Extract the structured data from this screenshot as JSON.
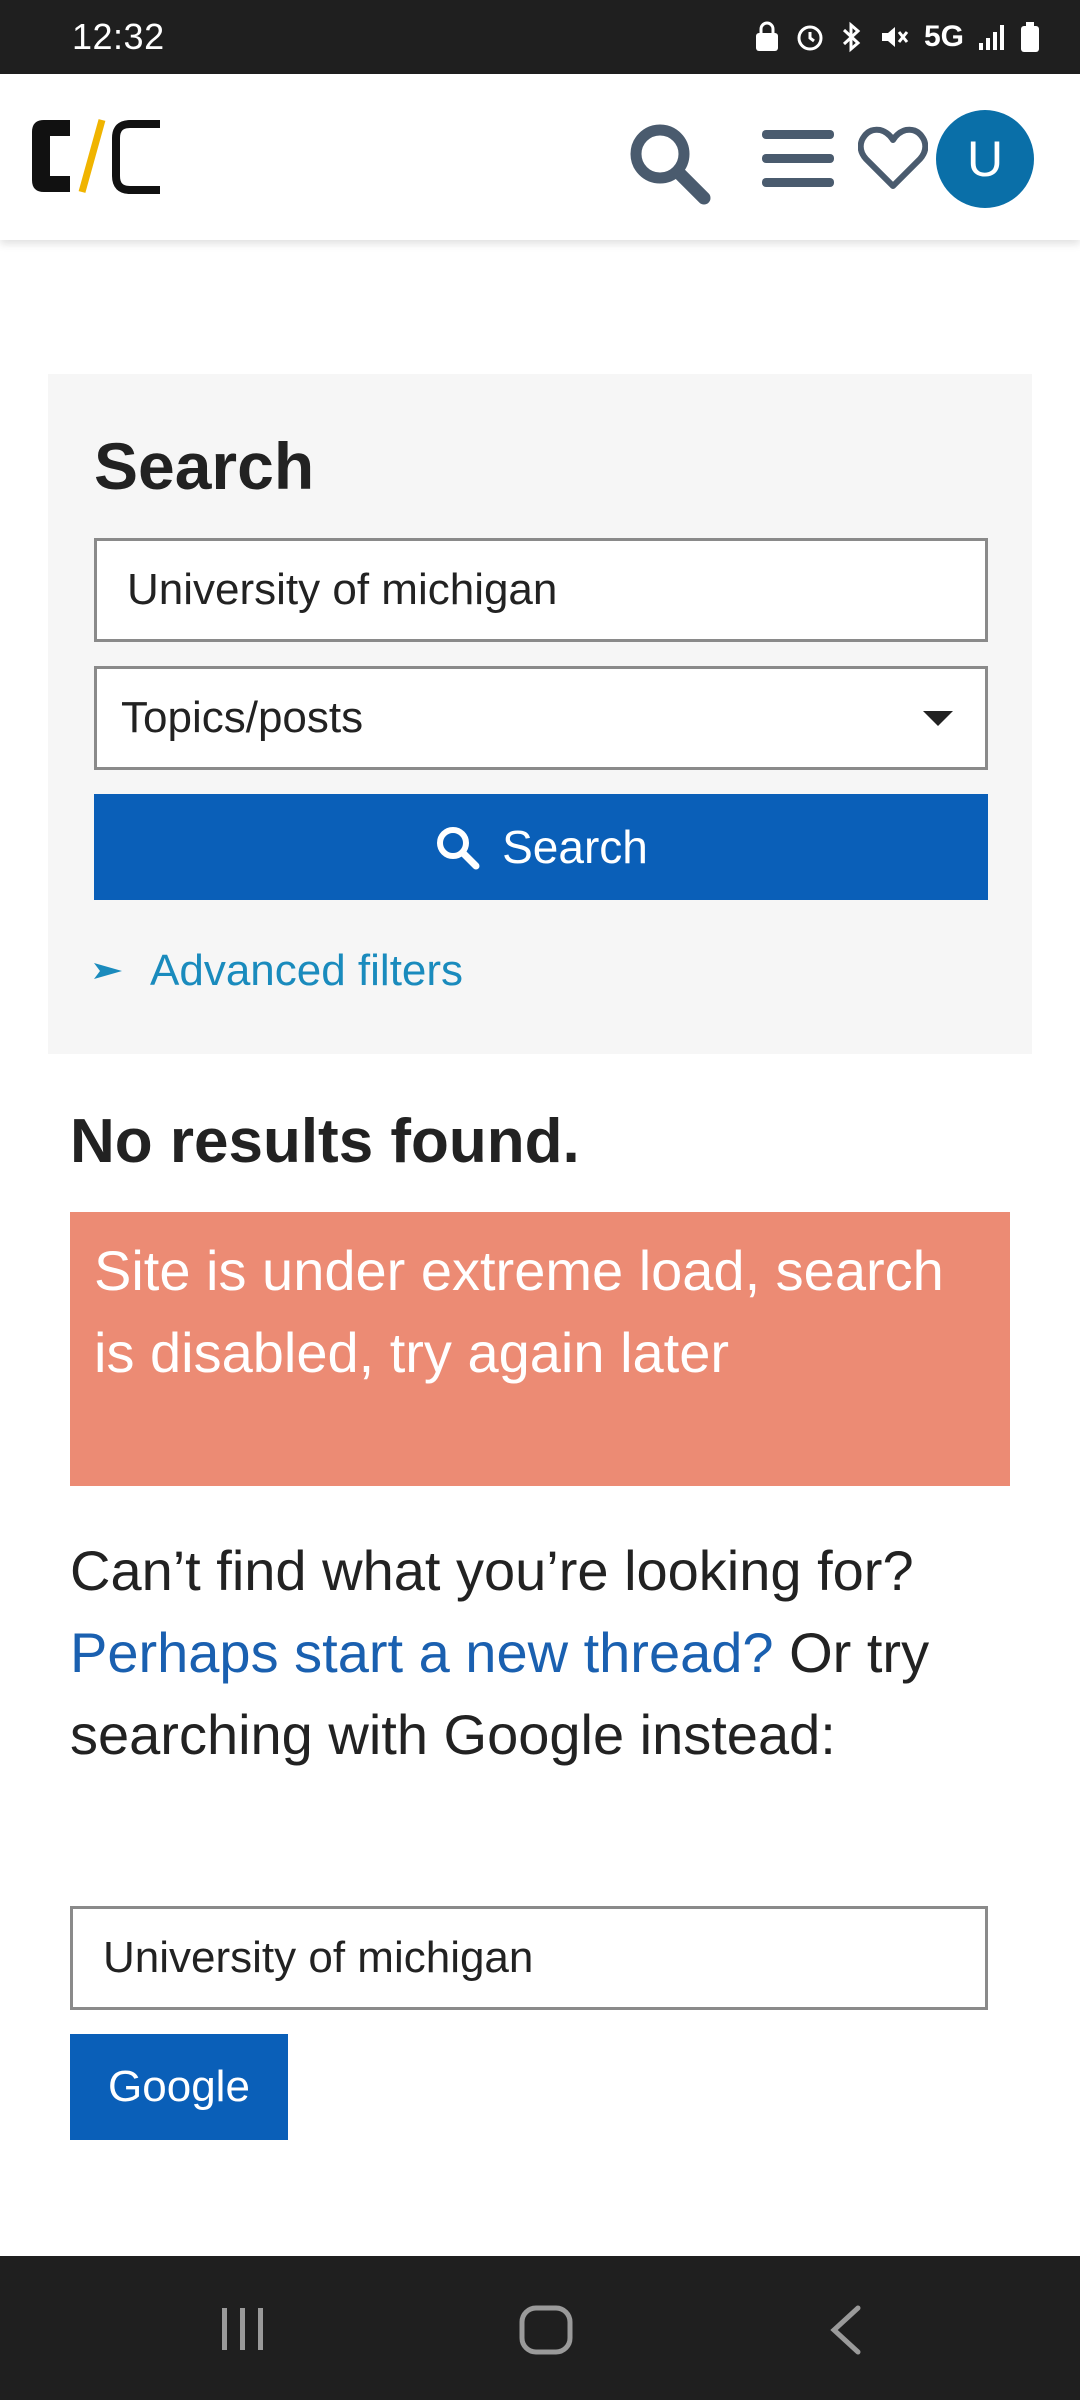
{
  "status_bar": {
    "time": "12:32",
    "network": "5G",
    "icons": [
      "lock-icon",
      "alarm-icon",
      "bluetooth-icon",
      "mute-icon",
      "signal-icon",
      "battery-icon"
    ]
  },
  "header": {
    "logo_text": "C/C",
    "avatar_initial": "U",
    "icons": [
      "search-icon",
      "menu-icon",
      "heart-icon"
    ]
  },
  "search_panel": {
    "title": "Search",
    "query_value": "University of michigan",
    "scope_selected": "Topics/posts",
    "search_button_label": "Search",
    "advanced_filters_label": "Advanced filters"
  },
  "results": {
    "heading": "No results found.",
    "alert_text": "Site is under extreme load, search is disabled, try again later",
    "help_prefix": "Can’t find what you’re looking for?",
    "help_link": "Perhaps start a new thread?",
    "help_suffix": "Or try searching with Google instead:",
    "google_query_value": "University of michigan",
    "google_button_label": "Google"
  },
  "colors": {
    "primary_button": "#0a5fb8",
    "alert_background": "#ec8b74",
    "link": "#1a60b0",
    "avatar": "#0a6fa8",
    "panel_background": "#f6f6f6"
  }
}
